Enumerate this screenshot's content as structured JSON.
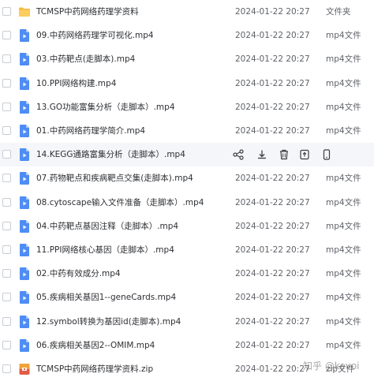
{
  "files": [
    {
      "name": "TCMSP中药网络药理学资料",
      "date": "2024-01-22 20:27",
      "type": "文件夹",
      "icon": "folder-icon"
    },
    {
      "name": "09.中药网络药理学可视化.mp4",
      "date": "2024-01-22 20:27",
      "type": "mp4文件",
      "icon": "video-file-icon"
    },
    {
      "name": "03.中药靶点(走脚本).mp4",
      "date": "2024-01-22 20:27",
      "type": "mp4文件",
      "icon": "video-file-icon"
    },
    {
      "name": "10.PPI网络构建.mp4",
      "date": "2024-01-22 20:27",
      "type": "mp4文件",
      "icon": "video-file-icon"
    },
    {
      "name": "13.GO功能富集分析（走脚本）.mp4",
      "date": "2024-01-22 20:27",
      "type": "mp4文件",
      "icon": "video-file-icon"
    },
    {
      "name": "01.中药网络药理学简介.mp4",
      "date": "2024-01-22 20:27",
      "type": "mp4文件",
      "icon": "video-file-icon"
    },
    {
      "name": "14.KEGG通路富集分析（走脚本）.mp4",
      "date": "",
      "type": "",
      "icon": "video-file-icon",
      "hover": true
    },
    {
      "name": "07.药物靶点和疾病靶点交集(走脚本).mp4",
      "date": "2024-01-22 20:27",
      "type": "mp4文件",
      "icon": "video-file-icon"
    },
    {
      "name": "08.cytoscape输入文件准备（走脚本）.mp4",
      "date": "2024-01-22 20:27",
      "type": "mp4文件",
      "icon": "video-file-icon"
    },
    {
      "name": "04.中药靶点基因注释（走脚本）.mp4",
      "date": "2024-01-22 20:27",
      "type": "mp4文件",
      "icon": "video-file-icon"
    },
    {
      "name": "11.PPI网络核心基因（走脚本）.mp4",
      "date": "2024-01-22 20:27",
      "type": "mp4文件",
      "icon": "video-file-icon"
    },
    {
      "name": "02.中药有效成分.mp4",
      "date": "2024-01-22 20:27",
      "type": "mp4文件",
      "icon": "video-file-icon"
    },
    {
      "name": "05.疾病相关基因1--geneCards.mp4",
      "date": "2024-01-22 20:27",
      "type": "mp4文件",
      "icon": "video-file-icon"
    },
    {
      "name": "12.symbol转换为基因id(走脚本).mp4",
      "date": "2024-01-22 20:27",
      "type": "mp4文件",
      "icon": "video-file-icon"
    },
    {
      "name": "06.疾病相关基因2--OMIM.mp4",
      "date": "2024-01-22 20:27",
      "type": "mp4文件",
      "icon": "video-file-icon"
    },
    {
      "name": "TCMSP中药网络药理学资料.zip",
      "date": "2024-01-22 20:27",
      "type": "zip文件",
      "icon": "zip-file-icon"
    }
  ],
  "hover_actions": [
    "share-icon",
    "download-icon",
    "delete-icon",
    "open-in-app-icon",
    "more-phone-icon"
  ],
  "watermark": "知乎 @kevoi",
  "colors": {
    "folder": "#f7b93c",
    "video": "#4e8df5",
    "zip_top": "#f0a33a",
    "zip_bottom": "#e25b45",
    "hover_row": "#f4f6fa",
    "text": "#2d2f33",
    "secondary_text": "#5f6268"
  }
}
